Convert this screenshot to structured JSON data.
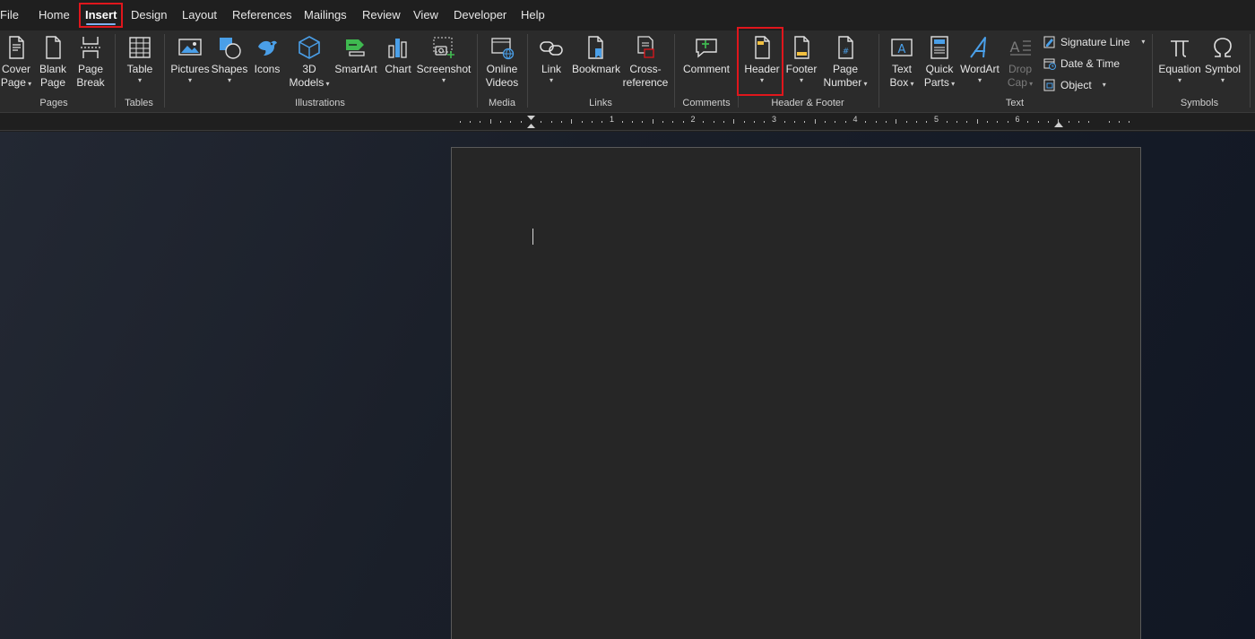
{
  "menu": {
    "tabs": [
      "File",
      "Home",
      "Insert",
      "Design",
      "Layout",
      "References",
      "Mailings",
      "Review",
      "View",
      "Developer",
      "Help"
    ],
    "active": "Insert"
  },
  "ribbon": {
    "pages": {
      "cover_page": [
        "Cover",
        "Page"
      ],
      "blank_page": [
        "Blank",
        "Page"
      ],
      "page_break": [
        "Page",
        "Break"
      ],
      "label": "Pages"
    },
    "tables": {
      "table": "Table",
      "label": "Tables"
    },
    "illustrations": {
      "pictures": "Pictures",
      "shapes": "Shapes",
      "icons": "Icons",
      "models": [
        "3D",
        "Models"
      ],
      "smartart": "SmartArt",
      "chart": "Chart",
      "screenshot": "Screenshot",
      "label": "Illustrations"
    },
    "media": {
      "online_videos": [
        "Online",
        "Videos"
      ],
      "label": "Media"
    },
    "links": {
      "link": "Link",
      "bookmark": "Bookmark",
      "cross_reference": [
        "Cross-",
        "reference"
      ],
      "label": "Links"
    },
    "comments": {
      "comment": "Comment",
      "label": "Comments"
    },
    "header_footer": {
      "header": "Header",
      "footer": "Footer",
      "page_number": [
        "Page",
        "Number"
      ],
      "label": "Header & Footer"
    },
    "text": {
      "text_box": [
        "Text",
        "Box"
      ],
      "quick_parts": [
        "Quick",
        "Parts"
      ],
      "wordart": "WordArt",
      "drop_cap": [
        "Drop",
        "Cap"
      ],
      "signature_line": "Signature Line",
      "date_time": "Date & Time",
      "object": "Object",
      "label": "Text"
    },
    "symbols": {
      "equation": "Equation",
      "symbol": "Symbol",
      "label": "Symbols"
    }
  },
  "ruler": {
    "numbers": [
      "1",
      "2",
      "3",
      "4",
      "5",
      "6"
    ]
  },
  "colors": {
    "highlight": "#e0161c",
    "accent_blue": "#4a9fe8",
    "accent_yellow": "#f2c040",
    "accent_green": "#3fb950"
  }
}
